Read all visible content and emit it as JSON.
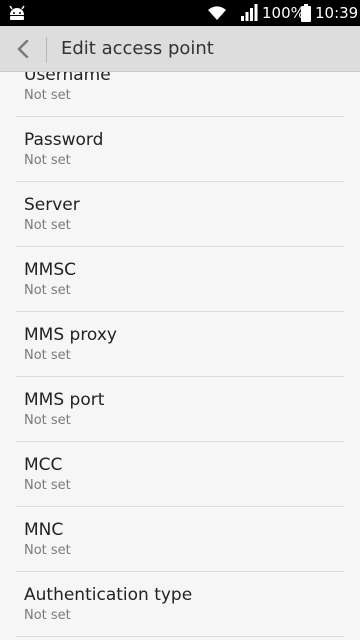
{
  "status_bar": {
    "battery_percent": "100%",
    "time": "10:39",
    "icons": [
      "android-icon",
      "wifi-icon",
      "signal-icon",
      "battery-icon"
    ]
  },
  "app_bar": {
    "title": "Edit access point",
    "back_icon": "chevron-left-icon"
  },
  "settings": [
    {
      "title": "Username",
      "value": "Not set"
    },
    {
      "title": "Password",
      "value": "Not set"
    },
    {
      "title": "Server",
      "value": "Not set"
    },
    {
      "title": "MMSC",
      "value": "Not set"
    },
    {
      "title": "MMS proxy",
      "value": "Not set"
    },
    {
      "title": "MMS port",
      "value": "Not set"
    },
    {
      "title": "MCC",
      "value": "Not set"
    },
    {
      "title": "MNC",
      "value": "Not set"
    },
    {
      "title": "Authentication type",
      "value": "Not set"
    }
  ],
  "colors": {
    "status_bar_bg": "#000000",
    "app_bar_bg": "#dddddd",
    "page_bg": "#f6f6f6",
    "title_text": "#222222",
    "secondary_text": "#7a7a7a",
    "divider": "#dcdcdc"
  }
}
